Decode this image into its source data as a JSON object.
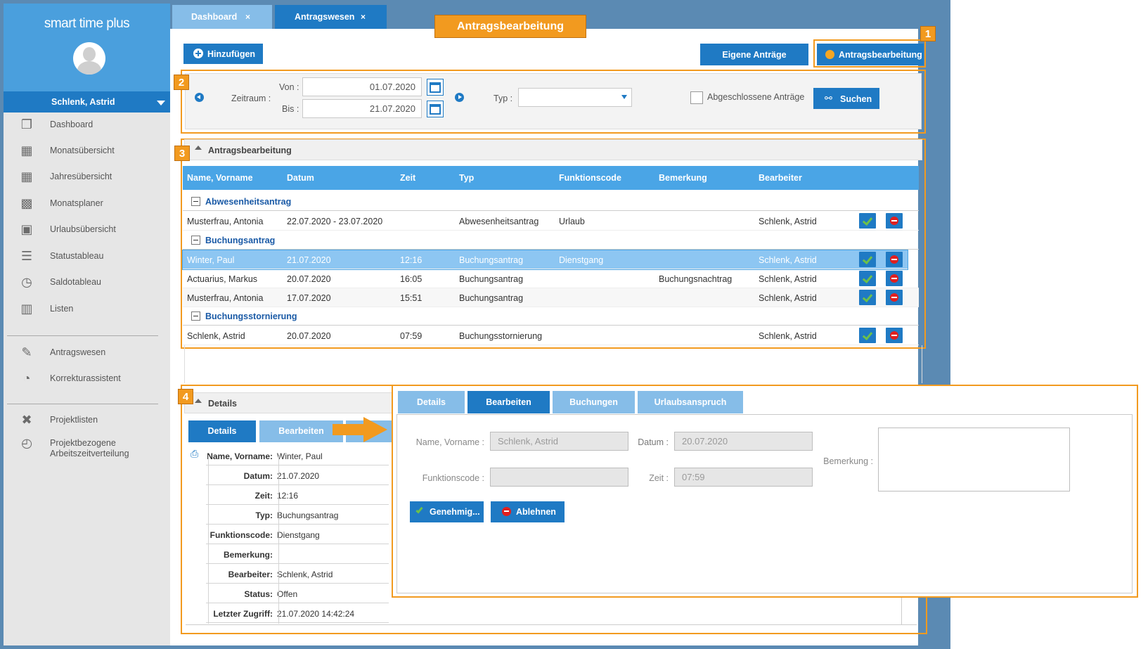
{
  "app": {
    "title": "smart time plus",
    "user": "Schlenk, Astrid"
  },
  "sidebar": {
    "items": [
      {
        "label": "Dashboard",
        "icon": "dashboard-icon"
      },
      {
        "label": "Monatsübersicht",
        "icon": "calendar-month-icon"
      },
      {
        "label": "Jahresübersicht",
        "icon": "calendar-year-icon"
      },
      {
        "label": "Monatsplaner",
        "icon": "planner-icon"
      },
      {
        "label": "Urlaubsübersicht",
        "icon": "vacation-calendar-icon"
      },
      {
        "label": "Statustableau",
        "icon": "list-icon"
      },
      {
        "label": "Saldotableau",
        "icon": "clock-sheet-icon"
      },
      {
        "label": "Listen",
        "icon": "book-icon"
      },
      {
        "label": "Antragswesen",
        "icon": "edit-document-icon"
      },
      {
        "label": "Korrekturassistent",
        "icon": "clock-icon"
      },
      {
        "label": "Projektlisten",
        "icon": "tools-icon"
      },
      {
        "label": "Projektbezogene Arbeitszeitverteilung",
        "icon": "project-clock-icon"
      }
    ]
  },
  "tabs": [
    {
      "label": "Dashboard",
      "close": "×"
    },
    {
      "label": "Antragswesen",
      "close": "×"
    }
  ],
  "callout_title": "Antragsbearbeitung",
  "markers": [
    "1",
    "2",
    "3",
    "4"
  ],
  "toolbar": {
    "add_label": "Hinzufügen",
    "own_requests_label": "Eigene Anträge",
    "processing_label": "Antragsbearbeitung"
  },
  "filter": {
    "zeitraum_label": "Zeitraum :",
    "von_label": "Von :",
    "von_value": "01.07.2020",
    "bis_label": "Bis :",
    "bis_value": "21.07.2020",
    "typ_label": "Typ :",
    "typ_value": "",
    "closed_label": "Abgeschlossene Anträge",
    "search_label": "Suchen"
  },
  "grid": {
    "section_title": "Antragsbearbeitung",
    "columns": [
      "Name, Vorname",
      "Datum",
      "Zeit",
      "Typ",
      "Funktionscode",
      "Bemerkung",
      "Bearbeiter"
    ],
    "groups": [
      "Abwesenheitsantrag",
      "Buchungsantrag",
      "Buchungsstornierung"
    ],
    "rows": [
      {
        "name": "Musterfrau, Antonia",
        "datum": "22.07.2020 - 23.07.2020",
        "zeit": "",
        "typ": "Abwesenheitsantrag",
        "funktionscode": "Urlaub",
        "bemerkung": "",
        "bearbeiter": "Schlenk, Astrid"
      },
      {
        "name": "Winter, Paul",
        "datum": "21.07.2020",
        "zeit": "12:16",
        "typ": "Buchungsantrag",
        "funktionscode": "Dienstgang",
        "bemerkung": "",
        "bearbeiter": "Schlenk, Astrid"
      },
      {
        "name": "Actuarius, Markus",
        "datum": "20.07.2020",
        "zeit": "16:05",
        "typ": "Buchungsantrag",
        "funktionscode": "",
        "bemerkung": "Buchungsnachtrag",
        "bearbeiter": "Schlenk, Astrid"
      },
      {
        "name": "Musterfrau, Antonia",
        "datum": "17.07.2020",
        "zeit": "15:51",
        "typ": "Buchungsantrag",
        "funktionscode": "",
        "bemerkung": "",
        "bearbeiter": "Schlenk, Astrid"
      },
      {
        "name": "Schlenk, Astrid",
        "datum": "20.07.2020",
        "zeit": "07:59",
        "typ": "Buchungsstornierung",
        "funktionscode": "",
        "bemerkung": "",
        "bearbeiter": "Schlenk, Astrid"
      }
    ]
  },
  "details": {
    "section_title": "Details",
    "tabs": [
      "Details",
      "Bearbeiten"
    ],
    "fields": [
      {
        "k": "Name, Vorname:",
        "v": "Winter, Paul"
      },
      {
        "k": "Datum:",
        "v": "21.07.2020"
      },
      {
        "k": "Zeit:",
        "v": "12:16"
      },
      {
        "k": "Typ:",
        "v": "Buchungsantrag"
      },
      {
        "k": "Funktionscode:",
        "v": "Dienstgang"
      },
      {
        "k": "Bemerkung:",
        "v": ""
      },
      {
        "k": "Bearbeiter:",
        "v": "Schlenk, Astrid"
      },
      {
        "k": "Status:",
        "v": "Offen"
      },
      {
        "k": "Letzter Zugriff:",
        "v": "21.07.2020 14:42:24"
      }
    ]
  },
  "overlay": {
    "tabs": [
      "Details",
      "Bearbeiten",
      "Buchungen",
      "Urlaubsanspruch"
    ],
    "name_label": "Name, Vorname :",
    "name_value": "Schlenk, Astrid",
    "datum_label": "Datum :",
    "datum_value": "20.07.2020",
    "funktionscode_label": "Funktionscode :",
    "funktionscode_value": "",
    "zeit_label": "Zeit :",
    "zeit_value": "07:59",
    "bemerkung_label": "Bemerkung :",
    "approve_label": "Genehmig...",
    "reject_label": "Ablehnen"
  },
  "colors": {
    "primary": "#1f7ac4",
    "accent": "#f29a1f",
    "header": "#4aa5e6",
    "selected": "#8dc6f2"
  }
}
